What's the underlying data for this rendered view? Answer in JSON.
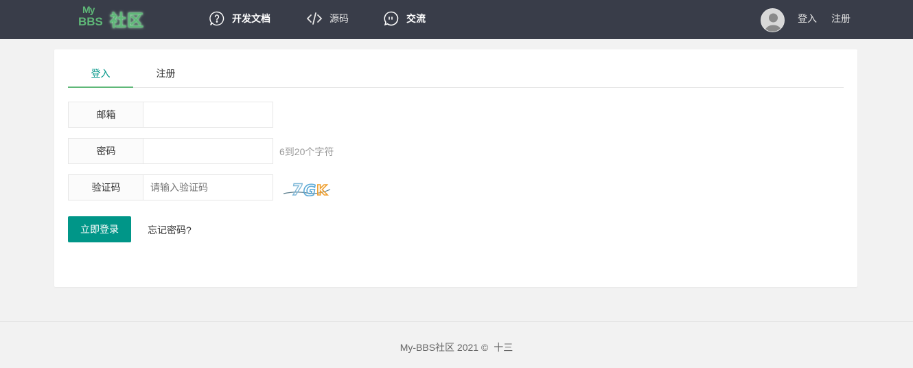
{
  "header": {
    "logo": {
      "my": "My",
      "bbs": "BBS",
      "cn": "社区"
    },
    "nav": [
      {
        "label": "开发文档",
        "icon": "question-circle-icon"
      },
      {
        "label": "源码",
        "icon": "code-icon"
      },
      {
        "label": "交流",
        "icon": "chat-bubble-icon"
      }
    ],
    "login_label": "登入",
    "register_label": "注册"
  },
  "tabs": [
    {
      "label": "登入",
      "active": true
    },
    {
      "label": "注册",
      "active": false
    }
  ],
  "form": {
    "email": {
      "label": "邮箱",
      "value": "",
      "placeholder": ""
    },
    "password": {
      "label": "密码",
      "value": "",
      "placeholder": "",
      "hint": "6到20个字符"
    },
    "captcha": {
      "label": "验证码",
      "value": "",
      "placeholder": "请输入验证码",
      "image_text": "7GK"
    },
    "submit_label": "立即登录",
    "forgot_label": "忘记密码?"
  },
  "footer": {
    "text": "My-BBS社区 2021 ©",
    "author": "十三"
  },
  "colors": {
    "header_bg": "#393d49",
    "accent": "#009688",
    "tab_underline": "#5fb878",
    "logo": "#5fb878"
  }
}
